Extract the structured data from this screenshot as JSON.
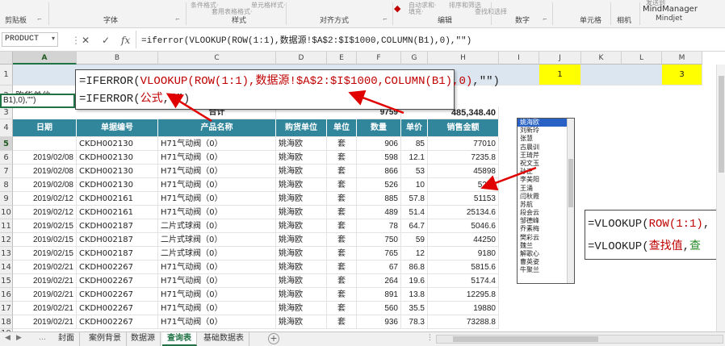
{
  "ribbon": {
    "groups": [
      "剪贴板",
      "字体",
      "样式",
      "对齐方式",
      "编辑",
      "数字",
      "单元格",
      "相机",
      "Mindjet"
    ],
    "faded": [
      "条件格式·",
      "套用表格格式·",
      "单元格样式·",
      "自动求和·",
      "填充·",
      "排序和筛选",
      "查找和选择"
    ],
    "mindmanager_top": "发送到",
    "mindmanager": "MindManager",
    "launcher": "⌐"
  },
  "formula_bar": {
    "name_box": "PRODUCT",
    "name_dropdown": "▾",
    "cancel": "✕",
    "enter": "✓",
    "fx": "fx",
    "formula": "=iferror(VLOOKUP(ROW(1:1),数据源!$A$2:$I$1000,COLUMN(B1),0),\"\")"
  },
  "columns": [
    "A",
    "B",
    "C",
    "D",
    "E",
    "F",
    "G",
    "H",
    "I",
    "J",
    "K",
    "L",
    "M"
  ],
  "row_numbers": [
    "1",
    "2",
    "3",
    "4",
    "5",
    "6",
    "7",
    "8",
    "9",
    "10",
    "11",
    "12",
    "13",
    "14",
    "15",
    "16",
    "17",
    "18",
    "19"
  ],
  "top": {
    "buyer_label": "购货单位:",
    "total_label": "合计",
    "total_qty": "9759",
    "total_amount": "485,348.40",
    "j1": "1",
    "m1": "3"
  },
  "headers": [
    "日期",
    "单据编号",
    "产品名称",
    "购货单位",
    "单位",
    "数量",
    "单价",
    "销售金额"
  ],
  "rows": [
    [
      "",
      "CKDH002130",
      "H71气动阀（0）",
      "姚海欧",
      "套",
      "906",
      "85",
      "77010"
    ],
    [
      "2019/02/08",
      "CKDH002130",
      "H71气动阀（0）",
      "姚海欧",
      "套",
      "598",
      "12.1",
      "7235.8"
    ],
    [
      "2019/02/08",
      "CKDH002130",
      "H71气动阀（0）",
      "姚海欧",
      "套",
      "866",
      "53",
      "45898"
    ],
    [
      "2019/02/08",
      "CKDH002130",
      "H71气动阀（0）",
      "姚海欧",
      "套",
      "526",
      "10",
      "5260"
    ],
    [
      "2019/02/12",
      "CKDH002161",
      "H71气动阀（0）",
      "姚海欧",
      "套",
      "885",
      "57.8",
      "51153"
    ],
    [
      "2019/02/12",
      "CKDH002161",
      "H71气动阀（0）",
      "姚海欧",
      "套",
      "489",
      "51.4",
      "25134.6"
    ],
    [
      "2019/02/15",
      "CKDH002187",
      "二片式球阀（0）",
      "姚海欧",
      "套",
      "78",
      "64.7",
      "5046.6"
    ],
    [
      "2019/02/15",
      "CKDH002187",
      "二片式球阀（0）",
      "姚海欧",
      "套",
      "750",
      "59",
      "44250"
    ],
    [
      "2019/02/15",
      "CKDH002187",
      "二片式球阀（0）",
      "姚海欧",
      "套",
      "765",
      "12",
      "9180"
    ],
    [
      "2019/02/21",
      "CKDH002267",
      "H71气动阀（0）",
      "姚海欧",
      "套",
      "67",
      "86.8",
      "5815.6"
    ],
    [
      "2019/02/21",
      "CKDH002267",
      "H71气动阀（0）",
      "姚海欧",
      "套",
      "264",
      "19.6",
      "5174.4"
    ],
    [
      "2019/02/21",
      "CKDH002267",
      "H71气动阀（0）",
      "姚海欧",
      "套",
      "891",
      "13.8",
      "12295.8"
    ],
    [
      "2019/02/21",
      "CKDH002267",
      "H71气动阀（0）",
      "姚海欧",
      "套",
      "560",
      "35.5",
      "19880"
    ],
    [
      "2019/02/21",
      "CKDH002267",
      "H71气动阀（0）",
      "姚海欧",
      "套",
      "936",
      "78.3",
      "73288.8"
    ]
  ],
  "editing_cell": "B1),0),\"\")",
  "callout": {
    "line1_prefix": "=IFERROR(",
    "line1_red": "VLOOKUP(ROW(1:1),数据源!$A$2:$I$1000,COLUMN(B1),0)",
    "line1_suffix": ",\"\")",
    "line2_prefix": "=IFERROR(",
    "line2_red": "公式",
    "line2_suffix": ",\"\")"
  },
  "dropdown_list": [
    "姚海欧",
    "刘新玲",
    "张慧",
    "古晨训",
    "王琦芹",
    "祝文玉",
    "孙正",
    "李美阳",
    "王涌",
    "闫秋霞",
    "苏航",
    "段会云",
    "邹德峰",
    "乔素梅",
    "樊彩云",
    "魏兰",
    "解歌心",
    "曹英姿",
    "牛聚兰"
  ],
  "note": {
    "line1_prefix": "=VLOOKUP(",
    "line1_red": "ROW(1:1)",
    "line1_suffix": ",",
    "line2_prefix": "=VLOOKUP(",
    "line2_red": "查找值",
    "line2_sep": ",",
    "line2_green": "查"
  },
  "sheet_tabs": [
    "封面",
    "案例背景",
    "数据源",
    "查询表",
    "基础数据表"
  ],
  "active_tab": "查询表",
  "tab_nav": [
    "◀",
    "▶",
    "…"
  ],
  "add_sheet": "+",
  "colors": {
    "header_teal": "#31869b",
    "yellow": "#ffff00",
    "band_blue": "#dce6f1",
    "accent_green": "#217346",
    "red": "#c00000"
  }
}
